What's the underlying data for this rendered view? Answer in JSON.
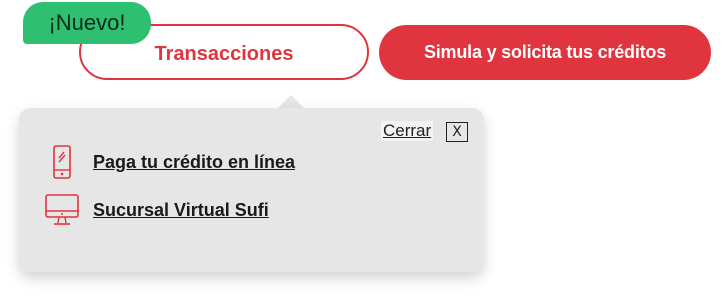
{
  "header": {
    "badge_label": "¡Nuevo!",
    "transacciones_label": "Transacciones",
    "simula_label": "Simula y solicita tus créditos"
  },
  "popover": {
    "close_label": "Cerrar",
    "close_x_label": "X",
    "items": [
      {
        "label": "Paga tu crédito en línea",
        "icon": "mobile-phone-icon"
      },
      {
        "label": "Sucursal Virtual Sufi",
        "icon": "desktop-monitor-icon"
      }
    ]
  },
  "colors": {
    "brand_red": "#e0343e",
    "badge_green": "#2fbf71",
    "popover_bg": "#e6e6e6"
  }
}
